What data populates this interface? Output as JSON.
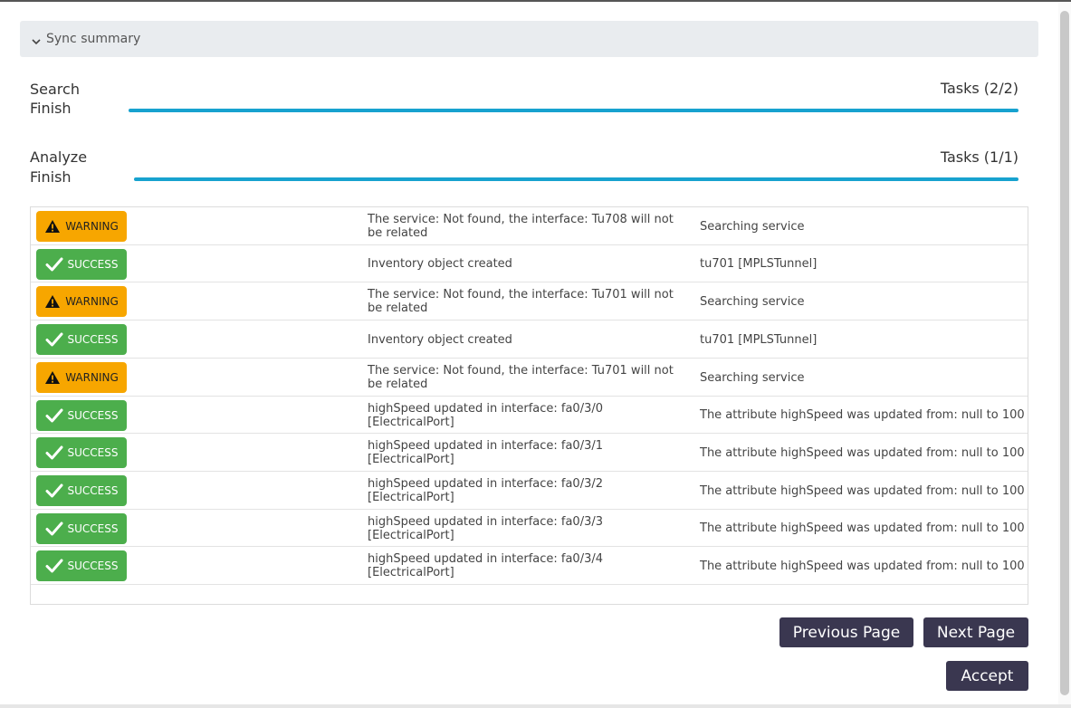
{
  "summary": {
    "title": "Sync summary"
  },
  "search": {
    "label_line1": "Search",
    "label_line2": "Finish",
    "tasks": "Tasks (2/2)",
    "progress": 1.0
  },
  "analyze": {
    "label_line1": "Analyze",
    "label_line2": "Finish",
    "tasks": "Tasks (1/1)",
    "progress": 1.0
  },
  "results": [
    {
      "status": "WARNING",
      "message": "The service: Not found, the interface: Tu708 will not be related",
      "detail": "Searching service"
    },
    {
      "status": "SUCCESS",
      "message": "Inventory object created",
      "detail": "tu701 [MPLSTunnel]"
    },
    {
      "status": "WARNING",
      "message": "The service: Not found, the interface: Tu701 will not be related",
      "detail": "Searching service"
    },
    {
      "status": "SUCCESS",
      "message": "Inventory object created",
      "detail": "tu701 [MPLSTunnel]"
    },
    {
      "status": "WARNING",
      "message": "The service: Not found, the interface: Tu701 will not be related",
      "detail": "Searching service"
    },
    {
      "status": "SUCCESS",
      "message": "highSpeed updated in interface: fa0/3/0 [ElectricalPort]",
      "detail": "The attribute highSpeed was updated from: null to 100"
    },
    {
      "status": "SUCCESS",
      "message": "highSpeed updated in interface: fa0/3/1 [ElectricalPort]",
      "detail": "The attribute highSpeed was updated from: null to 100"
    },
    {
      "status": "SUCCESS",
      "message": "highSpeed updated in interface: fa0/3/2 [ElectricalPort]",
      "detail": "The attribute highSpeed was updated from: null to 100"
    },
    {
      "status": "SUCCESS",
      "message": "highSpeed updated in interface: fa0/3/3 [ElectricalPort]",
      "detail": "The attribute highSpeed was updated from: null to 100"
    },
    {
      "status": "SUCCESS",
      "message": "highSpeed updated in interface: fa0/3/4 [ElectricalPort]",
      "detail": "The attribute highSpeed was updated from: null to 100"
    }
  ],
  "buttons": {
    "previous": "Previous Page",
    "next": "Next Page",
    "accept": "Accept"
  },
  "colors": {
    "warning": "#f7a600",
    "success": "#4cae4c",
    "progress": "#17a2cf",
    "button": "#3a3750"
  }
}
